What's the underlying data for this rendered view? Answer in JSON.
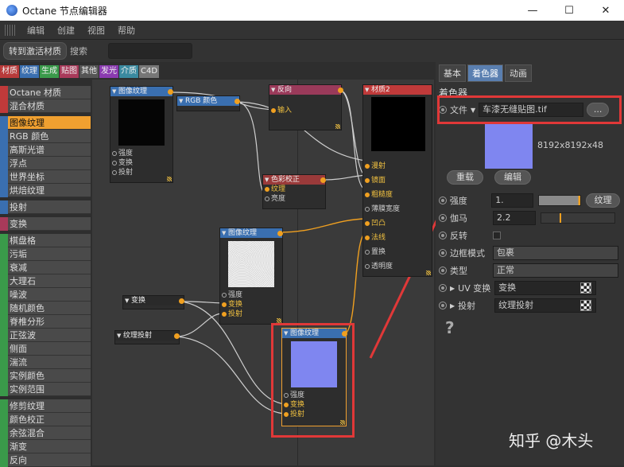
{
  "window": {
    "title": "Octane 节点编辑器",
    "min": "—",
    "max": "☐",
    "close": "✕"
  },
  "menu": [
    "编辑",
    "创建",
    "视图",
    "帮助"
  ],
  "toolbar": {
    "activate": "转到激活材质",
    "search_label": "搜索"
  },
  "categories": [
    {
      "label": "材质",
      "color": "#b83a3a"
    },
    {
      "label": "纹理",
      "color": "#3a6fb0"
    },
    {
      "label": "生成",
      "color": "#3a9a4a"
    },
    {
      "label": "贴图",
      "color": "#a83a5a"
    },
    {
      "label": "其他",
      "color": "#555555"
    },
    {
      "label": "发光",
      "color": "#8a3ab0"
    },
    {
      "label": "介质",
      "color": "#3a8aa0"
    },
    {
      "label": "C4D",
      "color": "#777777"
    }
  ],
  "sidebar": [
    {
      "label": "Octane 材质",
      "color": "#c03a3a"
    },
    {
      "label": "混合材质",
      "color": "#c03a3a"
    },
    {
      "gap": true
    },
    {
      "label": "图像纹理",
      "color": "#3a6fb0",
      "active": true
    },
    {
      "label": "RGB 颜色",
      "color": "#3a6fb0"
    },
    {
      "label": "高斯光谱",
      "color": "#3a6fb0"
    },
    {
      "label": "浮点",
      "color": "#3a6fb0"
    },
    {
      "label": "世界坐标",
      "color": "#3a6fb0"
    },
    {
      "label": "烘焙纹理",
      "color": "#3a6fb0"
    },
    {
      "gap": true
    },
    {
      "label": "投射",
      "color": "#3a6fb0"
    },
    {
      "gap": true
    },
    {
      "label": "变换",
      "color": "#a83a5a"
    },
    {
      "gap": true
    },
    {
      "label": "棋盘格",
      "color": "#3a9a4a"
    },
    {
      "label": "污垢",
      "color": "#3a9a4a"
    },
    {
      "label": "衰减",
      "color": "#3a9a4a"
    },
    {
      "label": "大理石",
      "color": "#3a9a4a"
    },
    {
      "label": "噪波",
      "color": "#3a9a4a"
    },
    {
      "label": "随机颜色",
      "color": "#3a9a4a"
    },
    {
      "label": "脊椎分形",
      "color": "#3a9a4a"
    },
    {
      "label": "正弦波",
      "color": "#3a9a4a"
    },
    {
      "label": "侧面",
      "color": "#3a9a4a"
    },
    {
      "label": "湍流",
      "color": "#3a9a4a"
    },
    {
      "label": "实例颜色",
      "color": "#3a9a4a"
    },
    {
      "label": "实例范围",
      "color": "#3a9a4a"
    },
    {
      "gap": true
    },
    {
      "label": "修剪纹理",
      "color": "#3a9a4a"
    },
    {
      "label": "颜色校正",
      "color": "#3a9a4a"
    },
    {
      "label": "余弦混合",
      "color": "#3a9a4a"
    },
    {
      "label": "渐变",
      "color": "#3a9a4a"
    },
    {
      "label": "反向",
      "color": "#3a9a4a"
    }
  ],
  "nodes": {
    "img1": {
      "title": "图像纹理",
      "ports": [
        "强度",
        "变换",
        "投射"
      ]
    },
    "rgb": {
      "title": "RGB 颜色"
    },
    "invert": {
      "title": "反向",
      "ports": [
        "输入"
      ]
    },
    "cc": {
      "title": "色彩校正",
      "ports": [
        "纹理",
        "亮度"
      ]
    },
    "mat": {
      "title": "材质2",
      "ports": [
        "漫射",
        "镜面",
        "粗糙度",
        "薄膜宽度",
        "凹凸",
        "法线",
        "置换",
        "透明度"
      ]
    },
    "img2": {
      "title": "图像纹理",
      "ports": [
        "强度",
        "变换",
        "投射"
      ]
    },
    "transform": {
      "title": "变换"
    },
    "projection": {
      "title": "纹理投射"
    },
    "img3": {
      "title": "图像纹理",
      "ports": [
        "强度",
        "变换",
        "投射"
      ]
    }
  },
  "right": {
    "tabs": [
      "基本",
      "着色器",
      "动画"
    ],
    "section": "着色器",
    "file_label": "文件",
    "file_value": "车漆无缝贴图.tif",
    "browse": "...",
    "resolution": "8192x8192x48",
    "reload": "重载",
    "edit": "编辑",
    "power_label": "强度",
    "power_value": "1.",
    "texture_btn": "纹理",
    "gamma_label": "伽马",
    "gamma_value": "2.2",
    "invert_label": "反转",
    "border_label": "边框模式",
    "border_value": "包裹",
    "type_label": "类型",
    "type_value": "正常",
    "uv_label": "UV 变换",
    "uv_value": "变换",
    "proj_label": "投射",
    "proj_value": "纹理投射",
    "help": "?"
  },
  "watermark": "知乎 @木头",
  "colors": {
    "accent": "#f0a030",
    "highlight": "#e03838",
    "texture_blue": "#7f86f0"
  }
}
